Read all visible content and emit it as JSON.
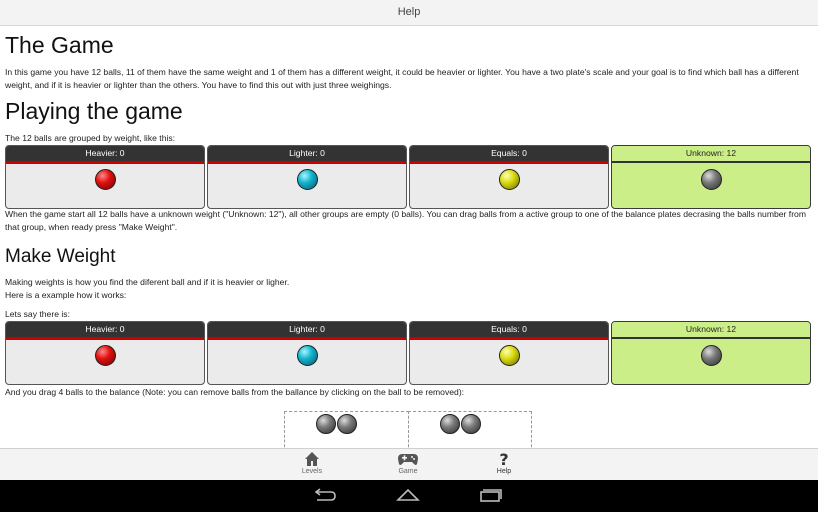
{
  "topbar": {
    "title": "Help"
  },
  "sections": {
    "game": {
      "title": "The Game",
      "text": "In this game you have 12 balls, 11 of them have the same weight and 1 of them has a different weight, it could be heavier or lighter. You have a two plate's scale and your goal is to find which ball has a different weight, and if it is heavier or lighter than the others. You have to find this out with just three weighings."
    },
    "playing": {
      "title": "Playing the game",
      "intro": "The 12 balls are grouped by weight, like this:",
      "groups": [
        {
          "label": "Heavier: 0",
          "ball": "red"
        },
        {
          "label": "Lighter: 0",
          "ball": "cyan"
        },
        {
          "label": "Equals: 0",
          "ball": "yellow"
        },
        {
          "label": "Unknown: 12",
          "ball": "gray"
        }
      ],
      "after": "When the game start all 12 balls have a unknown weight (\"Unknown: 12\"), all other groups are empty (0 balls).  You can drag balls from a active group to one of the balance plates decrasing the balls number from that group, when ready press \"Make Weight\"."
    },
    "make_weight": {
      "title": "Make Weight",
      "line1": "Making weights is how you find the diferent ball and if it is heavier or ligher.",
      "line2": "Here is a example how it works:",
      "line3": "Lets say there is:",
      "groups": [
        {
          "label": "Heavier: 0",
          "ball": "red"
        },
        {
          "label": "Lighter: 0",
          "ball": "cyan"
        },
        {
          "label": "Equals: 0",
          "ball": "yellow"
        },
        {
          "label": "Unknown: 12",
          "ball": "gray"
        }
      ],
      "after": "And you drag 4 balls to the balance (Note: you can remove balls from the ballance by clicking on the ball to be removed):"
    }
  },
  "tabs": [
    {
      "label": "Levels",
      "icon": "home-icon"
    },
    {
      "label": "Game",
      "icon": "gamepad-icon"
    },
    {
      "label": "Help",
      "icon": "question-icon"
    }
  ],
  "navbar": {
    "icons": [
      "back-icon",
      "home-icon",
      "recent-apps-icon"
    ]
  },
  "colors": {
    "unknown_bg": "#ccee88",
    "header_underline": "#cc0000",
    "header_bg": "#333333"
  }
}
